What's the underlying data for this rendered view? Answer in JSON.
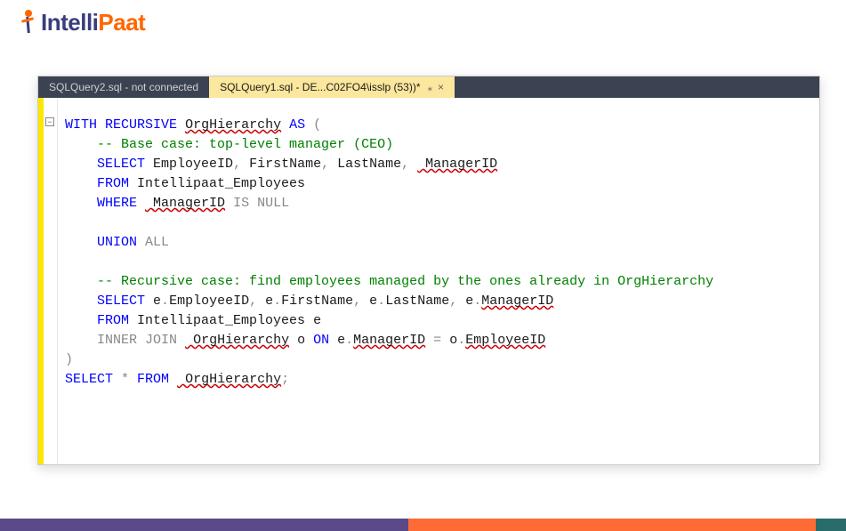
{
  "logo": {
    "brand_part1": "Intelli",
    "brand_part2": "Paat"
  },
  "tabs": {
    "inactive": {
      "label": "SQLQuery2.sql - not connected"
    },
    "active": {
      "label": "SQLQuery1.sql - DE...C02FO4\\isslp (53))*",
      "pin": "⁎",
      "close": "×"
    }
  },
  "outline_mark": "−",
  "code": {
    "l1_kw1": "WITH",
    "l1_kw2": "RECURSIVE",
    "l1_name": "OrgHierarchy",
    "l1_kw3": "AS",
    "l1_paren": "(",
    "l2": "-- Base case: top-level manager (CEO)",
    "l3_kw": "SELECT",
    "l3_c1": "EmployeeID",
    "l3_s1": ",",
    "l3_c2": " FirstName",
    "l3_s2": ",",
    "l3_c3": " LastName",
    "l3_s3": ",",
    "l3_c4": " ManagerID",
    "l4_kw": "FROM",
    "l4_t": " Intellipaat_Employees",
    "l5_kw": "WHERE",
    "l5_c": " ManagerID",
    "l5_op": " IS NULL",
    "l6_kw1": "UNION",
    "l6_kw2": " ALL",
    "l7": "-- Recursive case: find employees managed by the ones already in OrgHierarchy",
    "l8_kw": "SELECT",
    "l8_c1": " e",
    "l8_d1": ".",
    "l8_c1b": "EmployeeID",
    "l8_s1": ",",
    "l8_c2": " e",
    "l8_d2": ".",
    "l8_c2b": "FirstName",
    "l8_s2": ",",
    "l8_c3": " e",
    "l8_d3": ".",
    "l8_c3b": "LastName",
    "l8_s3": ",",
    "l8_c4": " e",
    "l8_d4": ".",
    "l8_c4b": "ManagerID",
    "l9_kw": "FROM",
    "l9_t": " Intellipaat_Employees e",
    "l10_kw1": "INNER",
    "l10_kw2": " JOIN",
    "l10_n": " OrgHierarchy",
    "l10_a": " o",
    "l10_kw3": " ON",
    "l10_l": " e",
    "l10_d1": ".",
    "l10_lb": "ManagerID",
    "l10_eq": " =",
    "l10_r": " o",
    "l10_d2": ".",
    "l10_rb": "EmployeeID",
    "l11": ")",
    "l12_kw1": "SELECT",
    "l12_star": " *",
    "l12_kw2": " FROM",
    "l12_n": " OrgHierarchy",
    "l12_semi": ";"
  }
}
